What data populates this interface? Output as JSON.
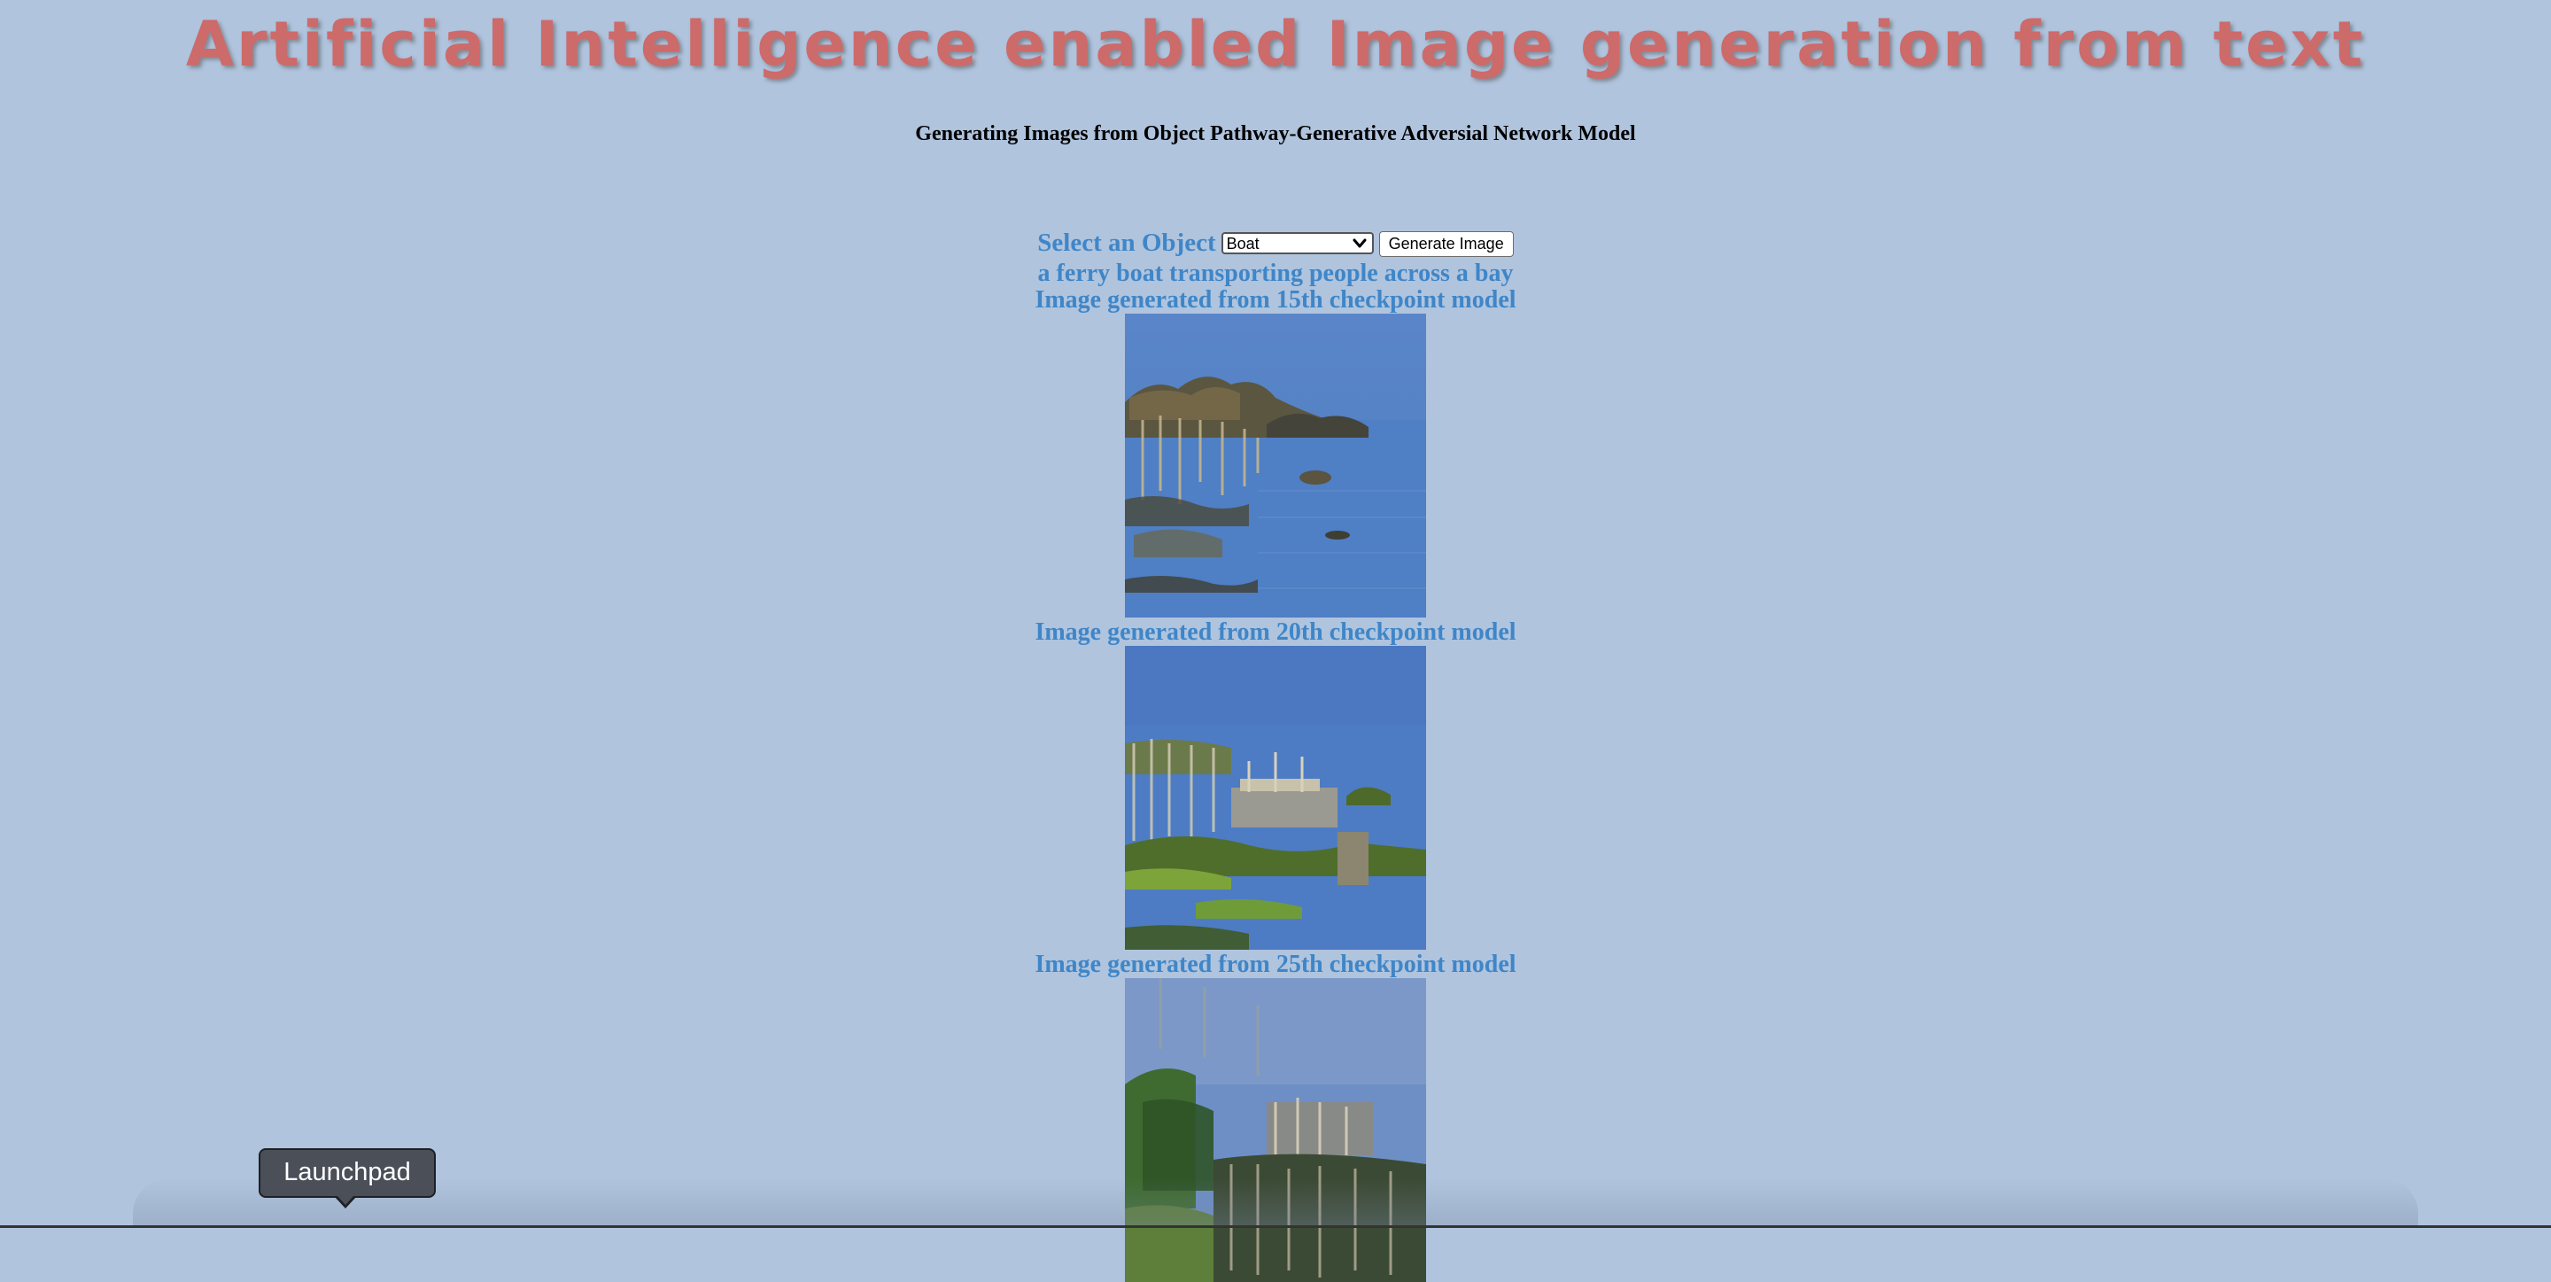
{
  "header": {
    "title": "Artificial Intelligence enabled Image generation from text",
    "subtitle": "Generating Images from Object Pathway-Generative Adversial Network Model"
  },
  "form": {
    "select_label": "Select an Object",
    "selected_object": "Boat",
    "generate_button_label": "Generate Image"
  },
  "result": {
    "prompt_text": "a ferry boat transporting people across a bay",
    "images": [
      {
        "caption": "Image generated from 15th checkpoint model"
      },
      {
        "caption": "Image generated from 20th checkpoint model"
      },
      {
        "caption": "Image generated from 25th checkpoint model"
      }
    ]
  },
  "dock": {
    "tooltip_label": "Launchpad"
  },
  "colors": {
    "background": "#b0c4de",
    "title": "#cd6a6a",
    "caption": "#3f86c8"
  }
}
